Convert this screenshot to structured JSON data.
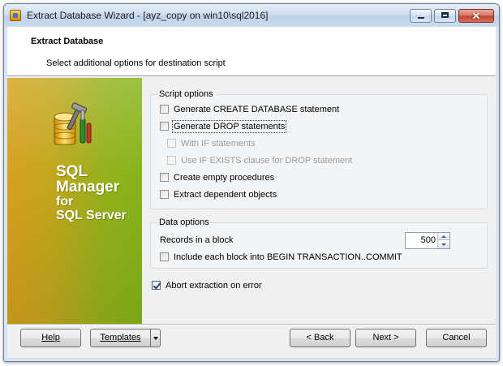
{
  "window": {
    "title": "Extract Database Wizard - [ayz_copy on win10\\sql2016]",
    "close_glyph": "✕"
  },
  "header": {
    "title": "Extract Database",
    "subtitle": "Select additional options for destination script"
  },
  "banner": {
    "line1": "SQL",
    "line2": "Manager",
    "line3": "for",
    "line4": "SQL Server",
    "icon": "database-tools-icon"
  },
  "script_options": {
    "legend": "Script options",
    "items": [
      {
        "label": "Generate CREATE DATABASE statement",
        "checked": false,
        "enabled": true
      },
      {
        "label": "Generate DROP statements",
        "checked": false,
        "enabled": true
      },
      {
        "label": "With IF statements",
        "checked": false,
        "enabled": false
      },
      {
        "label": "Use IF EXISTS clause for DROP statement",
        "checked": false,
        "enabled": false
      },
      {
        "label": "Create empty procedures",
        "checked": false,
        "enabled": true
      },
      {
        "label": "Extract dependent objects",
        "checked": false,
        "enabled": true
      }
    ]
  },
  "data_options": {
    "legend": "Data options",
    "records_label": "Records in a block",
    "records_value": "500",
    "include_label": "Include each block into BEGIN TRANSACTION..COMMIT",
    "include_checked": false
  },
  "abort": {
    "label": "Abort extraction on error",
    "checked": true
  },
  "buttons": {
    "help": "Help",
    "templates": "Templates",
    "back": "< Back",
    "next": "Next >",
    "cancel": "Cancel"
  }
}
